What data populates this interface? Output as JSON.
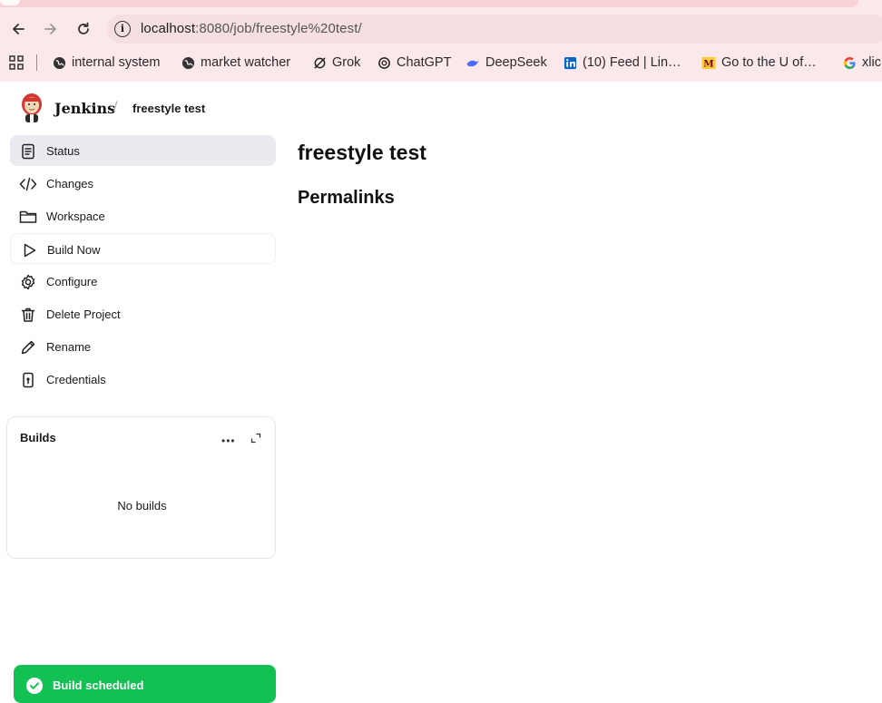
{
  "browser": {
    "url_host": "localhost",
    "url_rest": ":8080/job/freestyle%20test/",
    "bookmarks": [
      {
        "label": "internal system",
        "icon": "globe-icon"
      },
      {
        "label": "market watcher",
        "icon": "globe-icon"
      },
      {
        "label": "Grok",
        "icon": "grok-icon"
      },
      {
        "label": "ChatGPT",
        "icon": "chatgpt-icon"
      },
      {
        "label": "DeepSeek",
        "icon": "deepseek-icon"
      },
      {
        "label": "(10) Feed | Lin…",
        "icon": "linkedin-icon"
      },
      {
        "label": "Go to the U of…",
        "icon": "umn-icon"
      },
      {
        "label": "xlic",
        "icon": "google-icon"
      }
    ]
  },
  "header": {
    "brand": "Jenkins",
    "breadcrumb_sep": "/",
    "breadcrumb": "freestyle test"
  },
  "sidebar": {
    "items": [
      {
        "label": "Status",
        "icon": "status-icon"
      },
      {
        "label": "Changes",
        "icon": "code-icon"
      },
      {
        "label": "Workspace",
        "icon": "folder-icon"
      },
      {
        "label": "Build Now",
        "icon": "play-icon"
      },
      {
        "label": "Configure",
        "icon": "gear-icon"
      },
      {
        "label": "Delete Project",
        "icon": "trash-icon"
      },
      {
        "label": "Rename",
        "icon": "pencil-icon"
      },
      {
        "label": "Credentials",
        "icon": "credentials-icon"
      }
    ]
  },
  "builds": {
    "title": "Builds",
    "menu": "•••",
    "empty": "No builds"
  },
  "main": {
    "title": "freestyle test",
    "subtitle": "Permalinks"
  },
  "toast": {
    "label": "Build scheduled",
    "color": "#13c053"
  }
}
